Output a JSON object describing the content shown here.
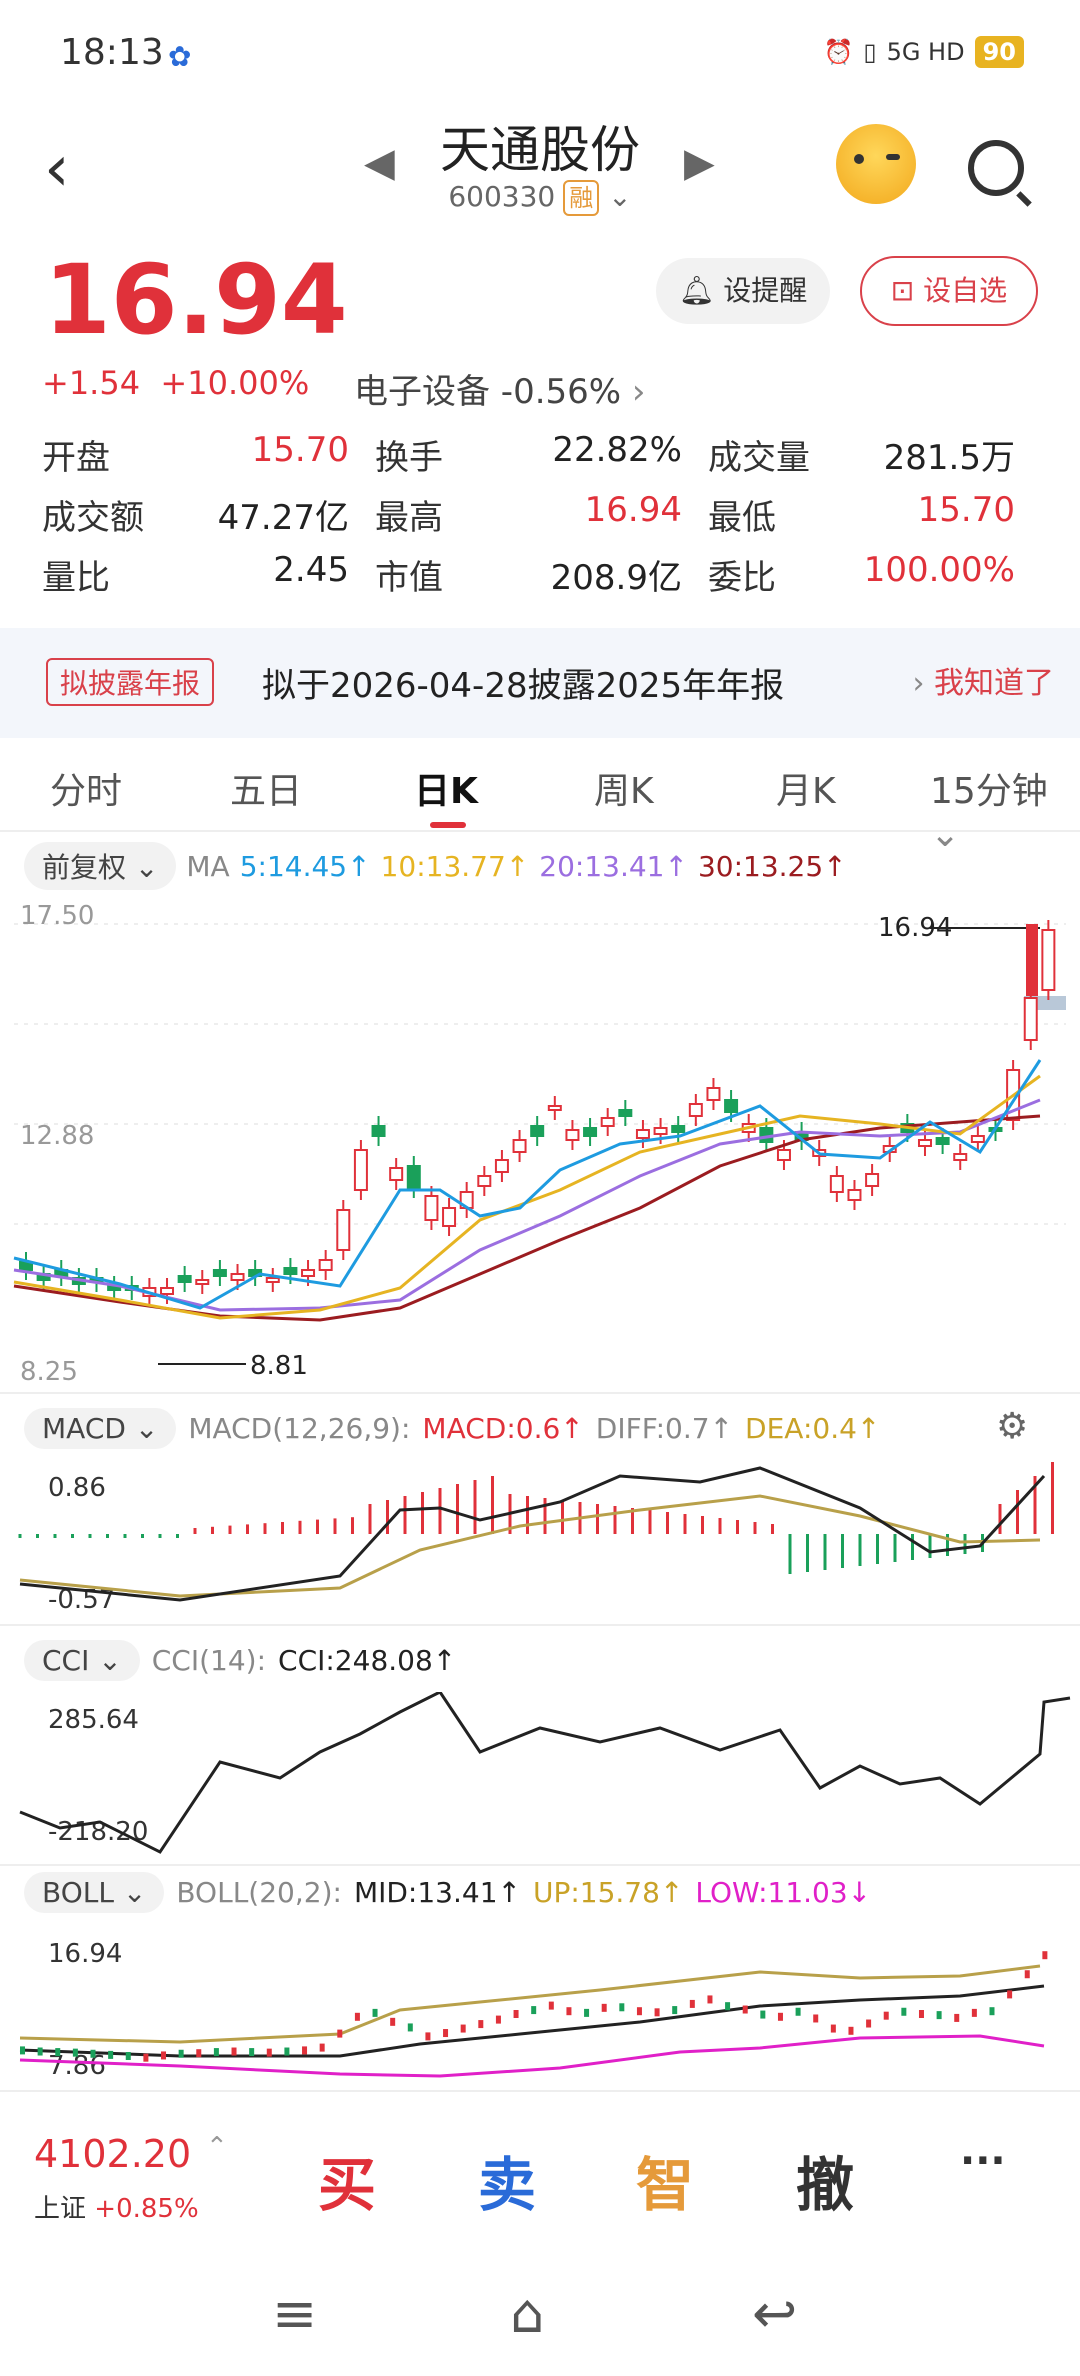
{
  "status": {
    "time": "18:13",
    "baidu": "✿",
    "net": "5G HD",
    "battery": "90"
  },
  "header": {
    "title": "天通股份",
    "code": "600330",
    "tag": "融",
    "prev": "◀",
    "next": "▶"
  },
  "quote": {
    "price": "16.94",
    "change": "+1.54",
    "pct": "+10.00%",
    "sector": "电子设备 -0.56%",
    "alert_label": "设提醒",
    "fav_label": "设自选"
  },
  "stats": [
    [
      {
        "k": "开盘",
        "v": "15.70",
        "c": "red"
      },
      {
        "k": "换手",
        "v": "22.82%",
        "c": ""
      },
      {
        "k": "成交量",
        "v": "281.5万",
        "c": ""
      }
    ],
    [
      {
        "k": "成交额",
        "v": "47.27亿",
        "c": ""
      },
      {
        "k": "最高",
        "v": "16.94",
        "c": "red"
      },
      {
        "k": "最低",
        "v": "15.70",
        "c": "red"
      }
    ],
    [
      {
        "k": "量比",
        "v": "2.45",
        "c": ""
      },
      {
        "k": "市值",
        "v": "208.9亿",
        "c": ""
      },
      {
        "k": "委比",
        "v": "100.00%",
        "c": "red"
      }
    ]
  ],
  "notice": {
    "tag": "拟披露年报",
    "text": "拟于2026-04-28披露2025年年报",
    "action": "我知道了"
  },
  "tabs": [
    "分时",
    "五日",
    "日K",
    "周K",
    "月K",
    "15分钟"
  ],
  "ma": {
    "adj": "前复权",
    "label": "MA",
    "m5": "5:14.45↑",
    "m10": "10:13.77↑",
    "m20": "20:13.41↑",
    "m30": "30:13.25↑"
  },
  "kchart": {
    "top": "17.50",
    "mid": "12.88",
    "bottom": "8.25",
    "high_label": "16.94",
    "low_label": "8.81"
  },
  "macd": {
    "name": "MACD",
    "params": "MACD(12,26,9):",
    "macd": "MACD:0.6↑",
    "diff": "DIFF:0.7↑",
    "dea": "DEA:0.4↑",
    "top": "0.86",
    "bottom": "-0.57"
  },
  "cci": {
    "name": "CCI",
    "params": "CCI(14):",
    "val": "CCI:248.08↑",
    "top": "285.64",
    "bottom": "-218.20"
  },
  "boll": {
    "name": "BOLL",
    "params": "BOLL(20,2):",
    "mid": "MID:13.41↑",
    "up": "UP:15.78↑",
    "low": "LOW:11.03↓",
    "top": "16.94",
    "bottom": "7.86"
  },
  "bottom": {
    "index": "4102.20",
    "index_name": "上证",
    "index_chg": "+0.85%",
    "buy": "买",
    "sell": "卖",
    "smart": "智",
    "cancel": "撤",
    "more": "···"
  },
  "nav": {
    "menu": "≡",
    "home": "⌂",
    "back": "↩"
  },
  "colors": {
    "up": "#e0313a",
    "down": "#1aa05a",
    "ma5": "#1e9be0",
    "ma10": "#e6b422",
    "ma20": "#9b6ee0",
    "ma30": "#9b1c20"
  }
}
